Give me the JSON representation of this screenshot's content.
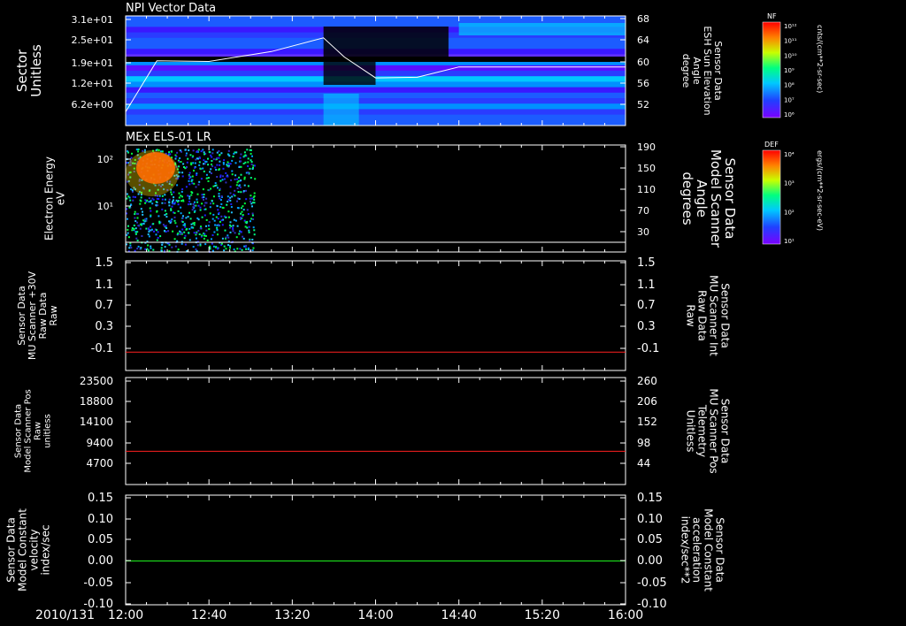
{
  "date_label": "2010/131",
  "time_ticks": [
    "12:00",
    "12:40",
    "13:20",
    "14:00",
    "14:40",
    "15:20",
    "16:00"
  ],
  "panels": [
    {
      "id": "npi",
      "title": "NPI Vector Data",
      "left_label": [
        "Sector",
        "Unitless"
      ],
      "left_ticks": [
        "3.1e+01",
        "2.5e+01",
        "1.9e+01",
        "1.2e+01",
        "6.2e+00"
      ],
      "right_label": [
        "Sensor Data",
        "ESH Sun Elevation",
        "Angle",
        "degree"
      ],
      "right_ticks": [
        "68",
        "64",
        "60",
        "56",
        "52"
      ],
      "colorbar": {
        "name": "NF",
        "ticks": [
          "10¹²",
          "10¹¹",
          "10¹⁰",
          "10⁹",
          "10⁸",
          "10⁷",
          "10⁶"
        ],
        "unit": "cnts/(cm**2-sr-sec)"
      }
    },
    {
      "id": "els",
      "title": "MEx ELS-01 LR",
      "left_label": [
        "Electron Energy",
        "eV"
      ],
      "left_ticks": [
        "10²",
        "10¹"
      ],
      "right_label": [
        "Sensor Data",
        "Model Scanner",
        "Angle",
        "degrees"
      ],
      "right_ticks": [
        "190",
        "150",
        "110",
        "70",
        "30"
      ],
      "colorbar": {
        "name": "DEF",
        "ticks": [
          "10⁴",
          "10³",
          "10²",
          "10¹"
        ],
        "unit": "ergs/(cm**2-sr-sec-eV)"
      }
    },
    {
      "id": "raw30",
      "left_label": [
        "Sensor Data",
        "MU Scanner +30V",
        "Raw Data",
        "Raw"
      ],
      "left_ticks": [
        "1.5",
        "1.1",
        "0.7",
        "0.3",
        "-0.1"
      ],
      "right_label": [
        "Sensor Data",
        "MU Scanner Int",
        "Raw Data",
        "Raw"
      ],
      "right_ticks": [
        "1.5",
        "1.1",
        "0.7",
        "0.3",
        "-0.1"
      ]
    },
    {
      "id": "pos",
      "left_label": [
        "Sensor Data",
        "Model Scanner Pos",
        "Raw",
        "unitless"
      ],
      "left_ticks": [
        "23500",
        "18800",
        "14100",
        "9400",
        "4700"
      ],
      "right_label": [
        "Sensor Data",
        "MU Scanner Pos",
        "Telemetry",
        "Unitless"
      ],
      "right_ticks": [
        "260",
        "206",
        "152",
        "98",
        "44"
      ]
    },
    {
      "id": "vel",
      "left_label": [
        "Sensor Data",
        "Model Constant",
        "velocity",
        "index/sec"
      ],
      "left_ticks": [
        "0.15",
        "0.10",
        "0.05",
        "0.00",
        "-0.05",
        "-0.10"
      ],
      "right_label": [
        "Sensor Data",
        "Model Constant",
        "acceleration",
        "index/sec**2"
      ],
      "right_ticks": [
        "0.15",
        "0.10",
        "0.05",
        "0.00",
        "-0.05",
        "-0.10"
      ]
    }
  ],
  "chart_data": [
    {
      "type": "heatmap",
      "title": "NPI Vector Data",
      "ylabel": "Sector Unitless",
      "y2label": "Sensor Data ESH Sun Elevation Angle degree",
      "y2lim": [
        48,
        68
      ],
      "overlay_line": {
        "x": [
          "12:00",
          "12:15",
          "12:40",
          "13:10",
          "13:35",
          "13:45",
          "14:00",
          "14:20",
          "14:40",
          "16:00"
        ],
        "y": [
          50.5,
          59.8,
          59.7,
          61.5,
          64.0,
          60.5,
          56.7,
          56.8,
          58.7,
          58.7
        ]
      }
    },
    {
      "type": "heatmap",
      "title": "MEx ELS-01 LR",
      "ylabel": "Electron Energy eV",
      "y2label": "Sensor Data Model Scanner Angle degrees",
      "y2lim": [
        10,
        190
      ],
      "data_extent": [
        "12:00",
        "13:02"
      ],
      "overlay_line": {
        "x": [
          "12:00",
          "16:00"
        ],
        "y": [
          14,
          14
        ]
      }
    },
    {
      "type": "line",
      "ylabel": "Sensor Data MU Scanner +30V Raw Data Raw",
      "y2label": "Sensor Data MU Scanner Int Raw Data Raw",
      "ylim": [
        -0.3,
        1.5
      ],
      "series": [
        {
          "color": "#ff2020",
          "x": [
            "12:00",
            "16:00"
          ],
          "y": [
            0.0,
            0.0
          ]
        }
      ]
    },
    {
      "type": "line",
      "ylabel": "Sensor Data Model Scanner Pos Raw unitless",
      "y2label": "Sensor Data MU Scanner Pos Telemetry Unitless",
      "ylim": [
        1000,
        23500
      ],
      "series": [
        {
          "color": "#ff2020",
          "x": [
            "12:00",
            "16:00"
          ],
          "y": [
            8000,
            8000
          ]
        }
      ]
    },
    {
      "type": "line",
      "ylabel": "Sensor Data Model Constant velocity index/sec",
      "y2label": "Sensor Data Model Constant acceleration index/sec**2",
      "ylim": [
        -0.1,
        0.15
      ],
      "series": [
        {
          "color": "#20ff20",
          "x": [
            "12:00",
            "16:00"
          ],
          "y": [
            0.0,
            0.0
          ]
        }
      ]
    }
  ]
}
